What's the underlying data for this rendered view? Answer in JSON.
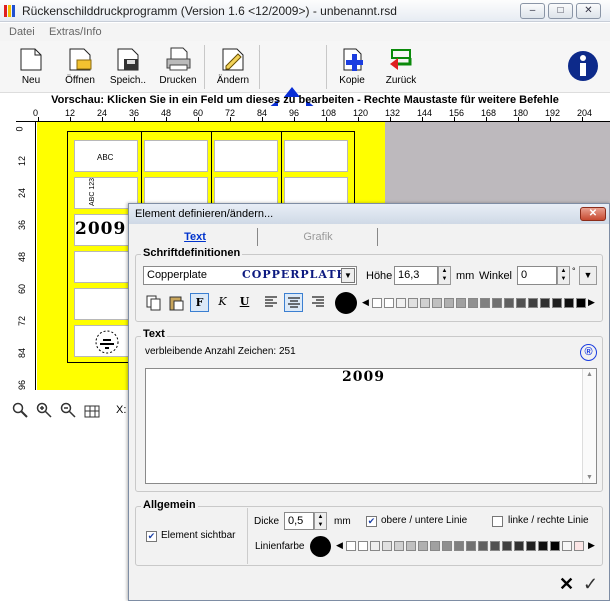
{
  "window": {
    "title": "Rückenschilddruckprogramm (Version 1.6 <12/2009>) - unbenannt.rsd",
    "min": "–",
    "max": "□",
    "close": "✕"
  },
  "menu": [
    "Datei",
    "Extras/Info"
  ],
  "toolbar": {
    "new": "Neu",
    "open": "Öffnen",
    "save": "Speich..",
    "print": "Drucken",
    "edit": "Ändern",
    "copy": "Kopie",
    "back": "Zurück"
  },
  "preview": {
    "caption": "Vorschau: Klicken Sie in ein Feld um dieses zu bearbeiten - Rechte Maustaste für weitere Befehle",
    "h_ticks": [
      "0",
      "12",
      "24",
      "36",
      "48",
      "60",
      "72",
      "84",
      "96",
      "108",
      "120",
      "132",
      "144",
      "156",
      "168",
      "180",
      "192",
      "204"
    ],
    "v_ticks": [
      "0",
      "12",
      "24",
      "36",
      "48",
      "60",
      "72",
      "84",
      "96"
    ],
    "cell_abc": "ABC",
    "cell_vertical": "ABC 123",
    "cell_year": "2009",
    "coord_label": "X:"
  },
  "dialog": {
    "title": "Element definieren/ändern...",
    "close": "✕",
    "tab_text": "Text",
    "tab_graphic": "Grafik",
    "font_group": "Schriftdefinitionen",
    "font_name": "Copperplate",
    "font_preview": "COPPERPLATE",
    "height_label": "Höhe",
    "height_value": "16,3",
    "height_unit": "mm",
    "angle_label": "Winkel",
    "angle_value": "0",
    "angle_unit": "°",
    "bold": "F",
    "italic": "K",
    "underline": "U",
    "text_group": "Text",
    "remaining": "verbleibende Anzahl Zeichen: 251",
    "registered": "®",
    "text_value": "2009",
    "general_group": "Allgemein",
    "visible_label": "Element sichtbar",
    "thickness_label": "Dicke",
    "thickness_value": "0,5",
    "thickness_unit": "mm",
    "top_bottom_label": "obere / untere Linie",
    "left_right_label": "linke / rechte Linie",
    "line_color_label": "Linienfarbe",
    "cancel": "✕",
    "ok": "✓"
  },
  "colors": {
    "yellow": "#ffff00",
    "canvas": "#bdb9bd",
    "accent": "#0a2fd6"
  }
}
